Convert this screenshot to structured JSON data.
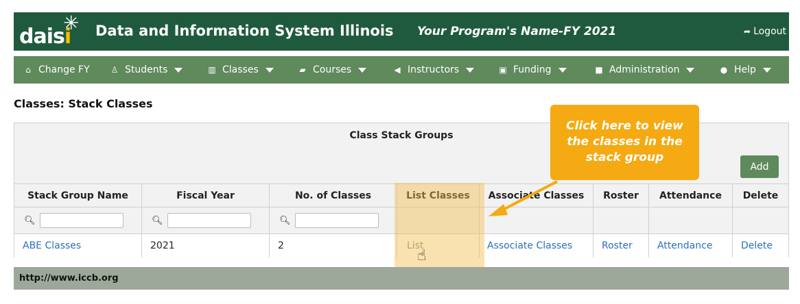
{
  "header": {
    "logo_text_main": "dais",
    "logo_text_i": "i",
    "title": "Data and Information System Illinois",
    "program_name": "Your Program's Name-FY 2021",
    "logout_label": "Logout"
  },
  "nav": {
    "items": [
      {
        "label": "Change FY",
        "icon": "home-icon",
        "dropdown": false
      },
      {
        "label": "Students",
        "icon": "person-icon",
        "dropdown": true
      },
      {
        "label": "Classes",
        "icon": "building-icon",
        "dropdown": true
      },
      {
        "label": "Courses",
        "icon": "book-icon",
        "dropdown": true
      },
      {
        "label": "Instructors",
        "icon": "bullhorn-icon",
        "dropdown": true
      },
      {
        "label": "Funding",
        "icon": "money-icon",
        "dropdown": true
      },
      {
        "label": "Administration",
        "icon": "folder-icon",
        "dropdown": true
      },
      {
        "label": "Help",
        "icon": "question-icon",
        "dropdown": true
      }
    ]
  },
  "page": {
    "title": "Classes: Stack Classes"
  },
  "table": {
    "group_title": "Class Stack Groups",
    "add_label": "Add",
    "columns": [
      "Stack Group Name",
      "Fiscal Year",
      "No. of Classes",
      "List Classes",
      "Associate Classes",
      "Roster",
      "Attendance",
      "Delete"
    ],
    "rows": [
      {
        "name": "ABE Classes",
        "fiscal_year": "2021",
        "num_classes": "2",
        "list": "List",
        "associate": "Associate Classes",
        "roster": "Roster",
        "attendance": "Attendance",
        "delete": "Delete"
      }
    ]
  },
  "callout": {
    "text": "Click here to view the classes in the stack group"
  },
  "footer": {
    "url": "http://www.iccb.org"
  },
  "colors": {
    "header_bg": "#1f5a3f",
    "nav_bg": "#5f8a5c",
    "callout": "#f5a912",
    "link": "#2a6fbd"
  }
}
